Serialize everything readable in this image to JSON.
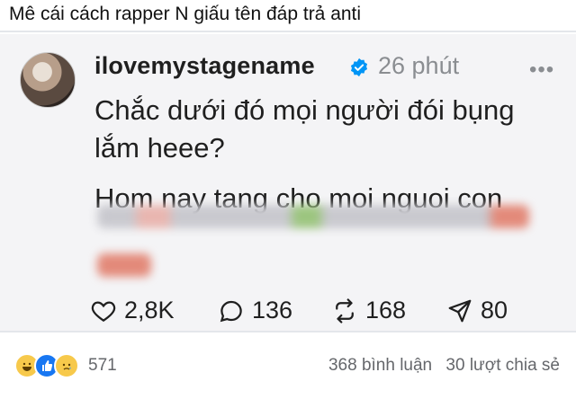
{
  "post": {
    "caption": "Mê cái cách rapper N giấu tên đáp trả anti"
  },
  "threads_post": {
    "username": "ilovemystagename",
    "time": "26 phút",
    "more_label": "•••",
    "body_lines": [
      "Chắc dưới đó mọi người đói bụng",
      "lắm heee?",
      "Hom nay tang cho moi nguoi con"
    ],
    "stats": {
      "likes": "2,8K",
      "comments": "136",
      "reposts": "168",
      "shares": "80"
    }
  },
  "footer": {
    "reaction_count": "571",
    "comments_label": "368 bình luận",
    "shares_label": "30 lượt chia sẻ",
    "reactions": [
      "haha",
      "like",
      "sad"
    ]
  },
  "colors": {
    "verified": "#0095f6",
    "muted": "#8a8d91",
    "like_blue": "#1877f2"
  }
}
